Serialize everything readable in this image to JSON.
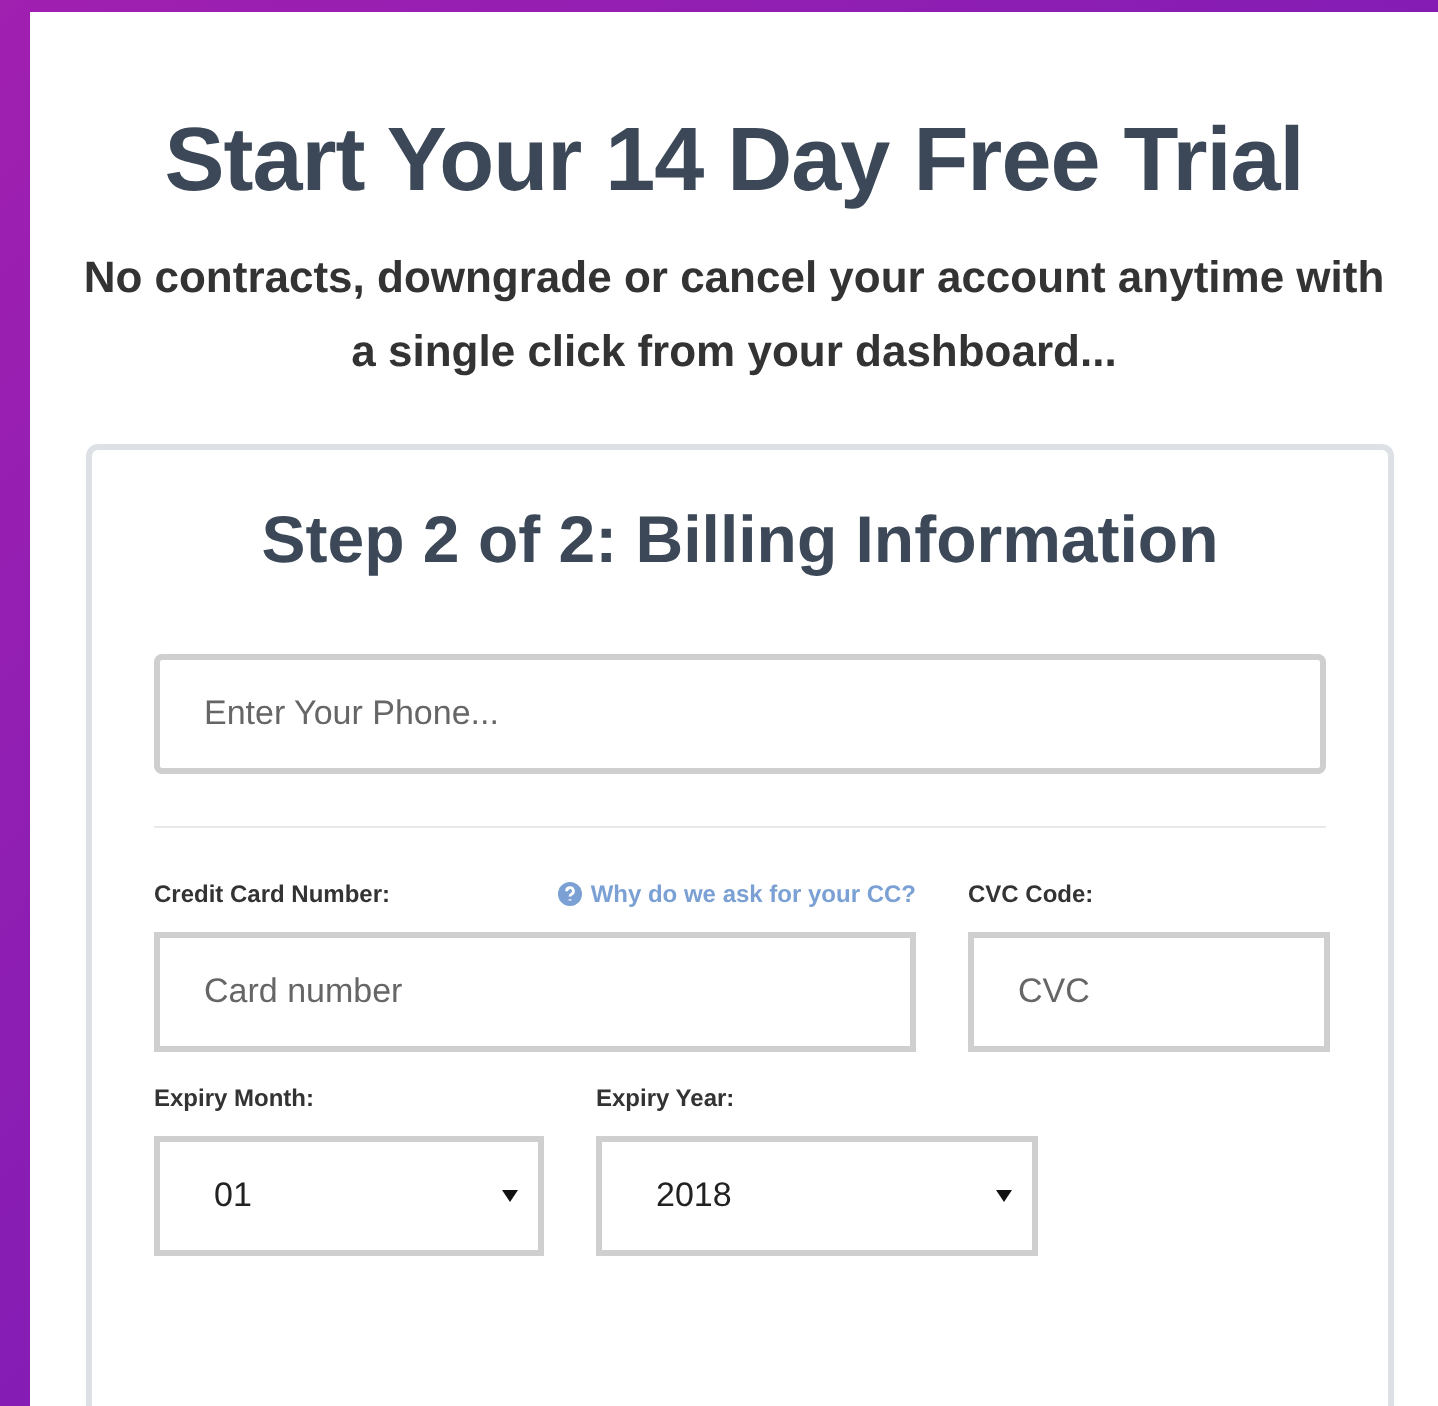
{
  "heading": "Start Your 14 Day Free Trial",
  "subheading": "No contracts, downgrade or cancel your account anytime with a single click from your dashboard...",
  "form": {
    "title": "Step 2 of 2: Billing Information",
    "phone": {
      "placeholder": "Enter Your Phone..."
    },
    "card_number": {
      "label": "Credit Card Number:",
      "help_link": "Why do we ask for your CC?",
      "placeholder": "Card number"
    },
    "cvc": {
      "label": "CVC Code:",
      "placeholder": "CVC"
    },
    "expiry_month": {
      "label": "Expiry Month:",
      "value": "01"
    },
    "expiry_year": {
      "label": "Expiry Year:",
      "value": "2018"
    }
  }
}
